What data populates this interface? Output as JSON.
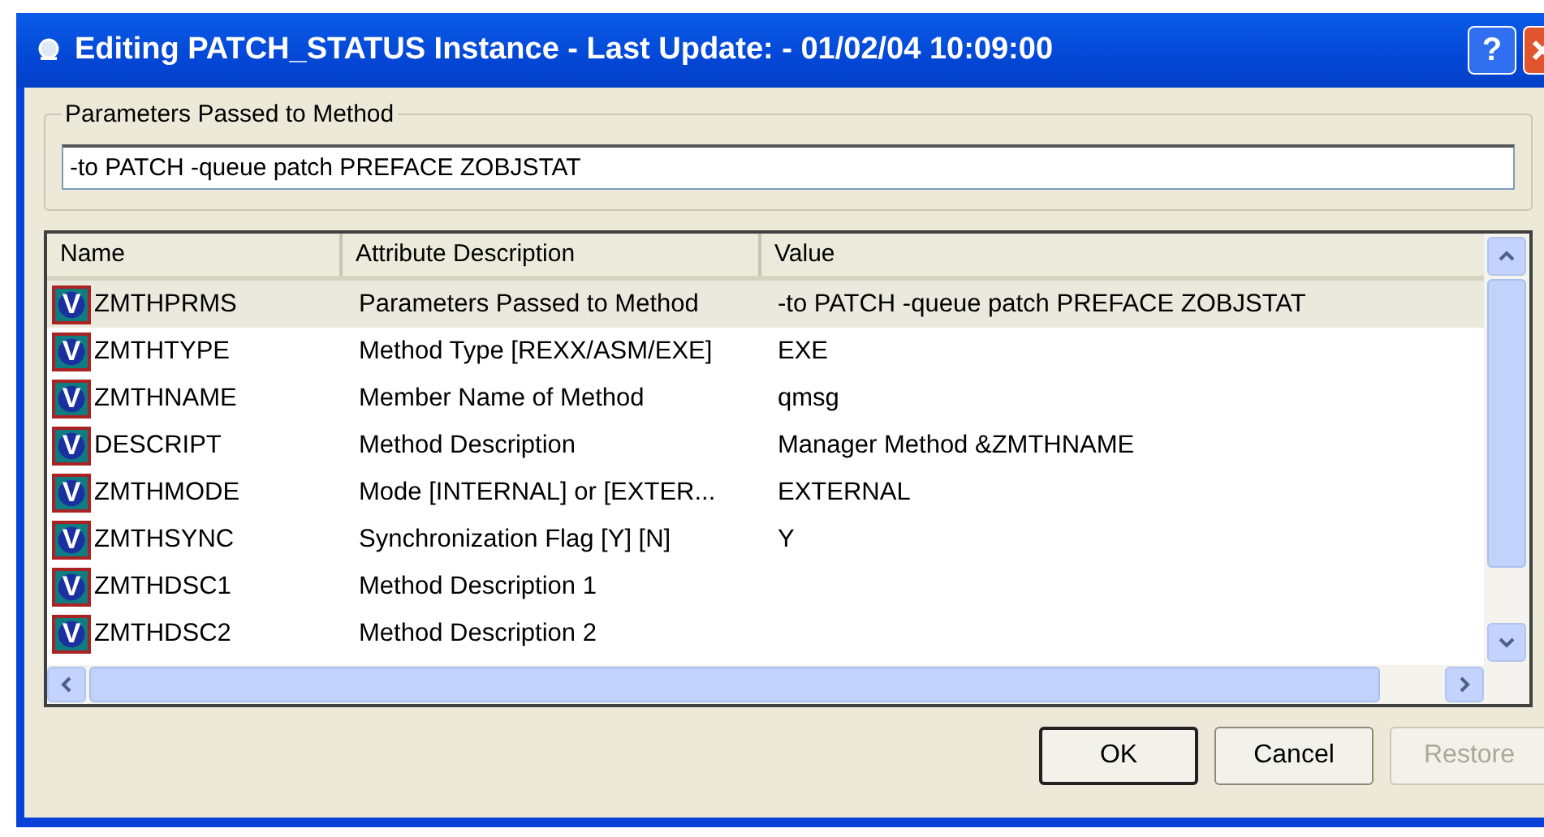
{
  "window": {
    "title": "Editing PATCH_STATUS Instance - Last Update: - 01/02/04 10:09:00",
    "help_button": "?"
  },
  "parameters": {
    "legend": "Parameters Passed to Method",
    "value": "-to PATCH -queue patch PREFACE ZOBJSTAT"
  },
  "table": {
    "columns": [
      "Name",
      "Attribute Description",
      "Value"
    ],
    "rows": [
      {
        "icon": "V",
        "name": "ZMTHPRMS",
        "description": "Parameters Passed to Method",
        "value": "-to PATCH -queue patch PREFACE ZOBJSTAT",
        "selected": true
      },
      {
        "icon": "V",
        "name": "ZMTHTYPE",
        "description": "Method Type [REXX/ASM/EXE]",
        "value": "EXE",
        "selected": false
      },
      {
        "icon": "V",
        "name": "ZMTHNAME",
        "description": "Member Name of Method",
        "value": "qmsg",
        "selected": false
      },
      {
        "icon": "V",
        "name": "DESCRIPT",
        "description": "Method Description",
        "value": "Manager Method &ZMTHNAME",
        "selected": false
      },
      {
        "icon": "V",
        "name": "ZMTHMODE",
        "description": "Mode [INTERNAL] or [EXTER...",
        "value": "EXTERNAL",
        "selected": false
      },
      {
        "icon": "V",
        "name": "ZMTHSYNC",
        "description": "Synchronization Flag [Y] [N]",
        "value": "Y",
        "selected": false
      },
      {
        "icon": "V",
        "name": "ZMTHDSC1",
        "description": "Method Description 1",
        "value": "",
        "selected": false
      },
      {
        "icon": "V",
        "name": "ZMTHDSC2",
        "description": "Method Description 2",
        "value": "",
        "selected": false
      }
    ]
  },
  "buttons": [
    {
      "label": "OK",
      "disabled": false,
      "default": true
    },
    {
      "label": "Cancel",
      "disabled": false,
      "default": false
    },
    {
      "label": "Restore",
      "disabled": true,
      "default": false
    }
  ]
}
